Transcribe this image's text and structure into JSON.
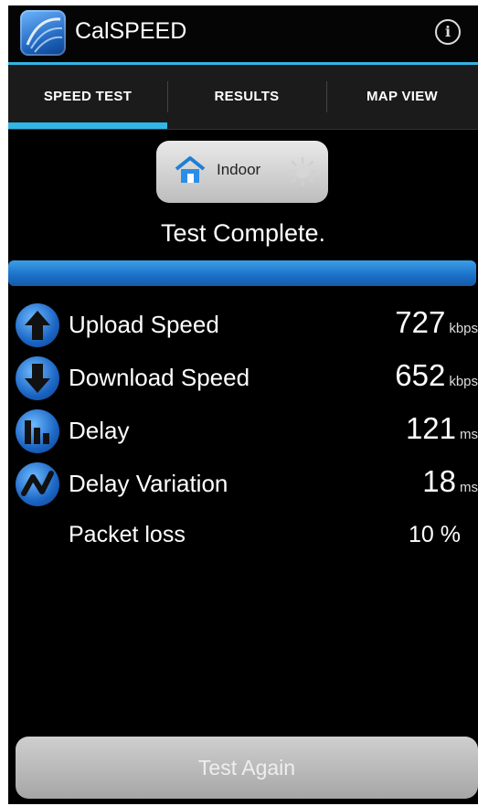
{
  "app": {
    "title": "CalSPEED",
    "icon": "calspeed-logo-icon",
    "info_icon": "info-icon"
  },
  "tabs": [
    {
      "label": "SPEED TEST",
      "active": true
    },
    {
      "label": "RESULTS",
      "active": false
    },
    {
      "label": "MAP VIEW",
      "active": false
    }
  ],
  "location_toggle": {
    "label": "Indoor",
    "icon": "house-icon",
    "secondary_icon": "sun-icon"
  },
  "status": "Test Complete.",
  "progress": {
    "percent": 100
  },
  "metrics": [
    {
      "label": "Upload Speed",
      "value": "727",
      "unit": "kbps",
      "icon": "upload-arrow-icon"
    },
    {
      "label": "Download Speed",
      "value": "652",
      "unit": "kbps",
      "icon": "download-arrow-icon"
    },
    {
      "label": "Delay",
      "value": "121",
      "unit": "ms",
      "icon": "delay-bars-icon"
    },
    {
      "label": "Delay Variation",
      "value": "18",
      "unit": "ms",
      "icon": "variation-zigzag-icon"
    }
  ],
  "packet_loss": {
    "label": "Packet loss",
    "value": "10 %"
  },
  "actions": {
    "test_again": "Test Again"
  },
  "colors": {
    "accent": "#33b5e5",
    "progress": "#1b6fc7",
    "background": "#000000"
  }
}
